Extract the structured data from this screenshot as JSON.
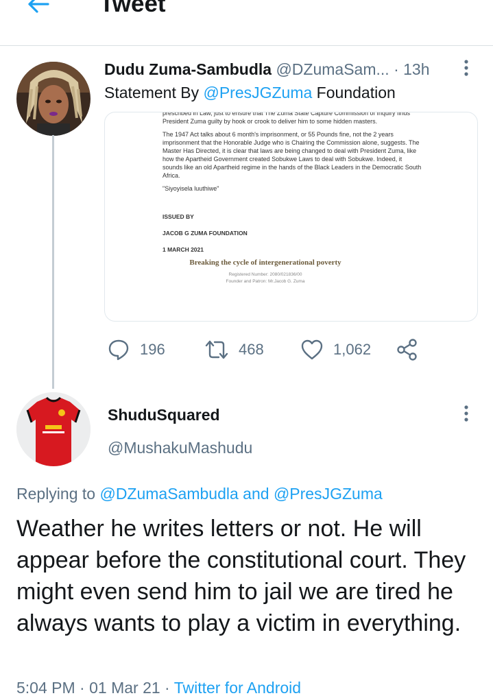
{
  "header": {
    "title": "Tweet",
    "back_icon": "arrow-left-icon"
  },
  "tweet1": {
    "display_name": "Dudu Zuma-Sambudla",
    "handle": "@DZumaSam...",
    "time": "· 13h",
    "text_before": "Statement By ",
    "mention": "@PresJGZuma",
    "text_after": " Foundation",
    "media": {
      "cut_line": "prescribed in Law, just to ensure that The Zuma State Capture Commission of Inquiry finds President Zuma guilty by hook or crook to deliver him to some hidden masters.",
      "paragraph": "The 1947 Act talks about 6 month's imprisonment, or 55 Pounds fine, not the 2 years imprisonment that the Honorable Judge who is Chairing the Commission alone, suggests. The Master Has Directed, it is clear that laws are being changed to deal with President Zuma, like how the Apartheid Government created Sobukwe Laws to deal with Sobukwe. Indeed, it sounds like an old Apartheid regime in the hands of the Black Leaders in the Democratic South Africa.",
      "quote": "\"Siyoyisela luuthiwe\"",
      "issued_by": "ISSUED BY",
      "org": "JACOB G ZUMA FOUNDATION",
      "date": "1 MARCH 2021",
      "motto": "Breaking the cycle of intergenerational poverty",
      "reg": "Registered Number: 2080/021836/00",
      "founder": "Founder and Patron: Mr.Jacob G. Zuma"
    },
    "actions": {
      "replies": "196",
      "retweets": "468",
      "likes": "1,062"
    }
  },
  "tweet2": {
    "display_name": "ShuduSquared",
    "handle": "@MushakuMashudu",
    "replying_prefix": "Replying to ",
    "replying_user1": "@DZumaSambudla",
    "replying_and": " and ",
    "replying_user2": "@PresJGZuma",
    "text": "Weather he writes letters or not. He will appear before the constitutional court. They might even send him to jail we are tired he always wants to play a victim in everything.",
    "time": "5:04 PM · 01 Mar 21 · ",
    "source": "Twitter for Android"
  },
  "colors": {
    "accent": "#1da1f2",
    "muted": "#5b7083",
    "text": "#14171a"
  }
}
